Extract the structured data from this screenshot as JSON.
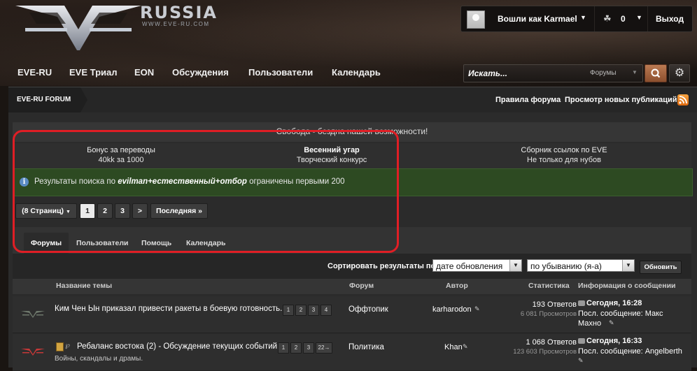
{
  "header": {
    "logo_text": "RUSSIA",
    "logo_url": "WWW.EVE-RU.COM",
    "user_label": "Вошли как Karmael",
    "alerts_count": "0",
    "logout": "Выход",
    "icons": {
      "avatar": "avatar",
      "alerts": "alert-icon",
      "caret": "chevron-down-icon"
    }
  },
  "nav": {
    "items": [
      "EVE-RU",
      "EVE Триал",
      "EON",
      "Обсуждения",
      "Пользователи",
      "Календарь"
    ]
  },
  "search": {
    "placeholder": "Искать...",
    "scope": "Форумы",
    "button_icon": "search-icon",
    "settings_icon": "gear-icon"
  },
  "breadcrumb": {
    "current": "EVE-RU FORUM",
    "links": [
      "Правила форума",
      "Просмотр новых публикаций"
    ],
    "rss_icon": "rss-icon"
  },
  "notice": "Свобода - бездна нашей возможности!",
  "promos": [
    {
      "title": "Бонус за переводы",
      "subtitle": "40kk за 1000",
      "bold": false
    },
    {
      "title": "Весенний угар",
      "subtitle": "Творческий конкурс",
      "bold": true
    },
    {
      "title": "Сборник ссылок по EVE",
      "subtitle": "Не только для нубов",
      "bold": false
    }
  ],
  "info": {
    "prefix": "Результаты поиска по",
    "query": "evilman+естественный+отбор",
    "suffix": "ограничены первыми 200"
  },
  "pagination": {
    "pages_label": "(8 Страниц)",
    "pages": [
      "1",
      "2",
      "3"
    ],
    "current": "1",
    "next": ">",
    "last": "Последняя »"
  },
  "tabs": [
    "Форумы",
    "Пользователи",
    "Помощь",
    "Календарь"
  ],
  "sort": {
    "label": "Сортировать результаты по",
    "field": "дате обновления",
    "order": "по убыванию (я-а)",
    "button": "Обновить"
  },
  "table": {
    "headers": [
      "Название темы",
      "Форум",
      "Автор",
      "Статистика",
      "Информация о сообщении"
    ],
    "rows": [
      {
        "title": "Ким Чен Ын приказал привести ракеты в боевую готовность.",
        "description": "",
        "pages": [
          "1",
          "2",
          "3",
          "4"
        ],
        "forum": "Оффтопик",
        "author": "karharodon",
        "replies": "193 Ответов",
        "views": "6 081 Просмотров",
        "last_time": "Сегодня, 16:28",
        "last_by": "Посл. сообщение: Макс",
        "last_by2": "Махно"
      },
      {
        "title": "Ребаланс востока (2) - Обсуждение текущих событий",
        "description": "Войны, скандалы и драмы.",
        "pages": [
          "1",
          "2",
          "3",
          "22→"
        ],
        "forum": "Политика",
        "author": "Khan",
        "replies": "1 068 Ответов",
        "views": "123 603 Просмотров",
        "last_time": "Сегодня, 16:33",
        "last_by": "Посл. сообщение: Angelberth",
        "last_by2": ""
      }
    ]
  },
  "colors": {
    "accent_search": "#a8643f",
    "info_green": "#2d4a22",
    "highlight_red": "#e01e25"
  }
}
